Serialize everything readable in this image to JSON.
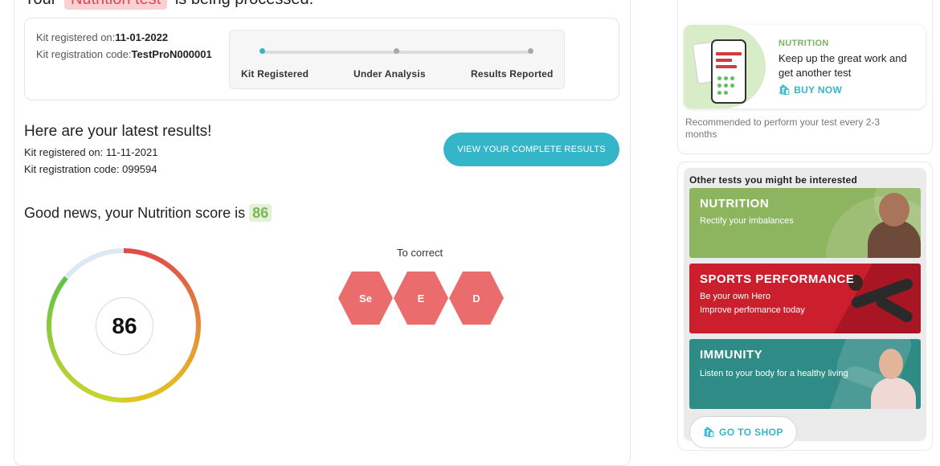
{
  "status": {
    "prefix": "Your",
    "test_name": "Nutrition test",
    "suffix": "is being processed."
  },
  "current_kit": {
    "registered_label": "Kit registered on:",
    "registered_date": "11-01-2022",
    "code_label": "Kit registration code:",
    "code_value": "TestProN000001",
    "steps": [
      "Kit Registered",
      "Under Analysis",
      "Results Reported"
    ],
    "active_step": 0
  },
  "latest": {
    "title": "Here are your latest results!",
    "registered": "Kit registered on: 11-11-2021",
    "code": "Kit registration code: 099594",
    "view_button": "VIEW YOUR COMPLETE RESULTS"
  },
  "score": {
    "text": "Good news, your Nutrition score is",
    "value": "86",
    "fraction": 0.86
  },
  "to_correct": {
    "title": "To correct",
    "items": [
      "Se",
      "E",
      "D"
    ]
  },
  "promo": {
    "tag": "NUTRITION",
    "text": "Keep up the great work and get another test",
    "buy_label": "BUY NOW",
    "recommendation": "Recommended to perform your test every 2-3 months"
  },
  "other_tests": {
    "title": "Other tests you might be interested",
    "tiles": [
      {
        "title": "NUTRITION",
        "lines": [
          "Rectify your imbalances"
        ],
        "color": "#8db45e"
      },
      {
        "title": "SPORTS PERFORMANCE",
        "lines": [
          "Be your own Hero",
          "Improve perfomance today"
        ],
        "color": "#cc1f2d"
      },
      {
        "title": "IMMUNITY",
        "lines": [
          "Listen to your body for a healthy living"
        ],
        "color": "#2f8b85"
      }
    ],
    "shop_label": "GO TO SHOP"
  },
  "colors": {
    "accent": "#35b6c8",
    "score_green": "#7ab55c",
    "hex_red": "#ea6c6c"
  },
  "icons": [
    "bag-icon",
    "shop-bag-icon"
  ]
}
